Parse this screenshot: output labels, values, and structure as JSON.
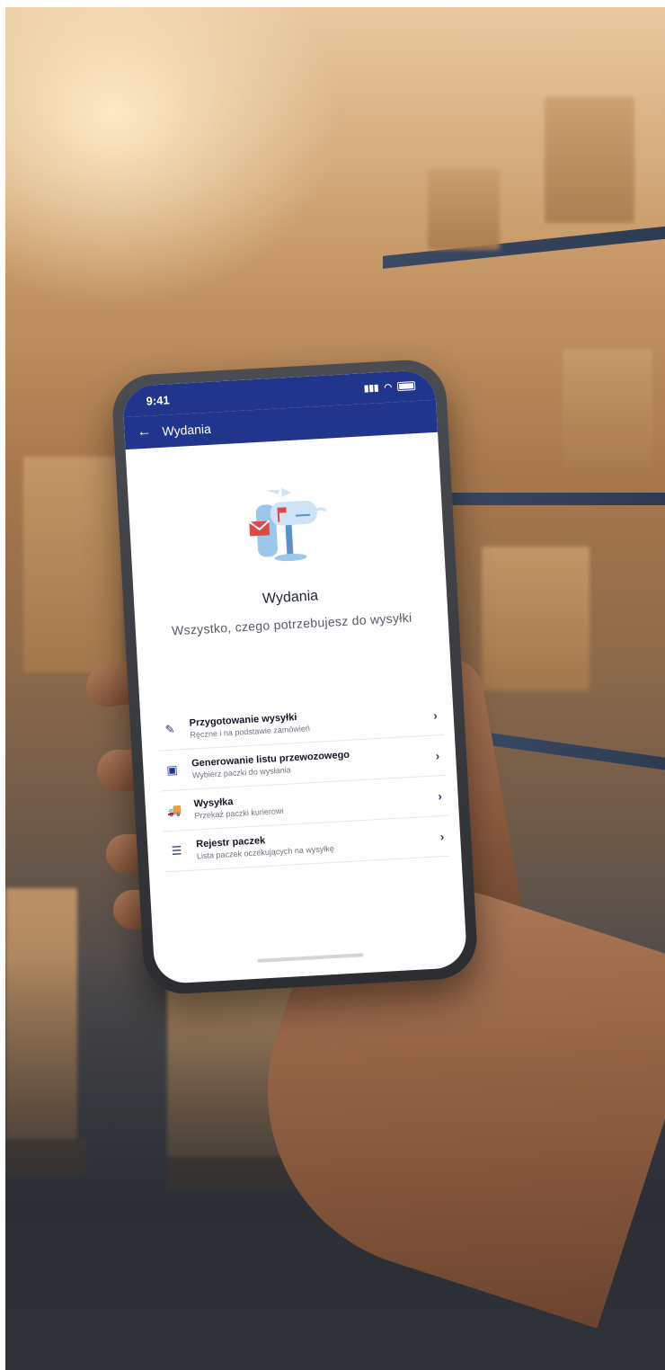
{
  "status_bar": {
    "time": "9:41"
  },
  "app_bar": {
    "title": "Wydania"
  },
  "hero": {
    "title": "Wydania",
    "subtitle": "Wszystko, czego potrzebujesz do wysyłki"
  },
  "menu": {
    "items": [
      {
        "icon": "pen-icon",
        "title": "Przygotowanie wysyłki",
        "description": "Ręczne i na podstawie zamówień"
      },
      {
        "icon": "document-icon",
        "title": "Generowanie listu przewozowego",
        "description": "Wybierz paczki do wysłania"
      },
      {
        "icon": "truck-icon",
        "title": "Wysyłka",
        "description": "Przekaż paczki kurierowi"
      },
      {
        "icon": "list-icon",
        "title": "Rejestr paczek",
        "description": "Lista paczek oczekujących na wysyłkę"
      }
    ]
  },
  "colors": {
    "header": "#22358c",
    "accent": "#22358c",
    "illustration_blue": "#9cc6ec",
    "illustration_red": "#e04848"
  }
}
